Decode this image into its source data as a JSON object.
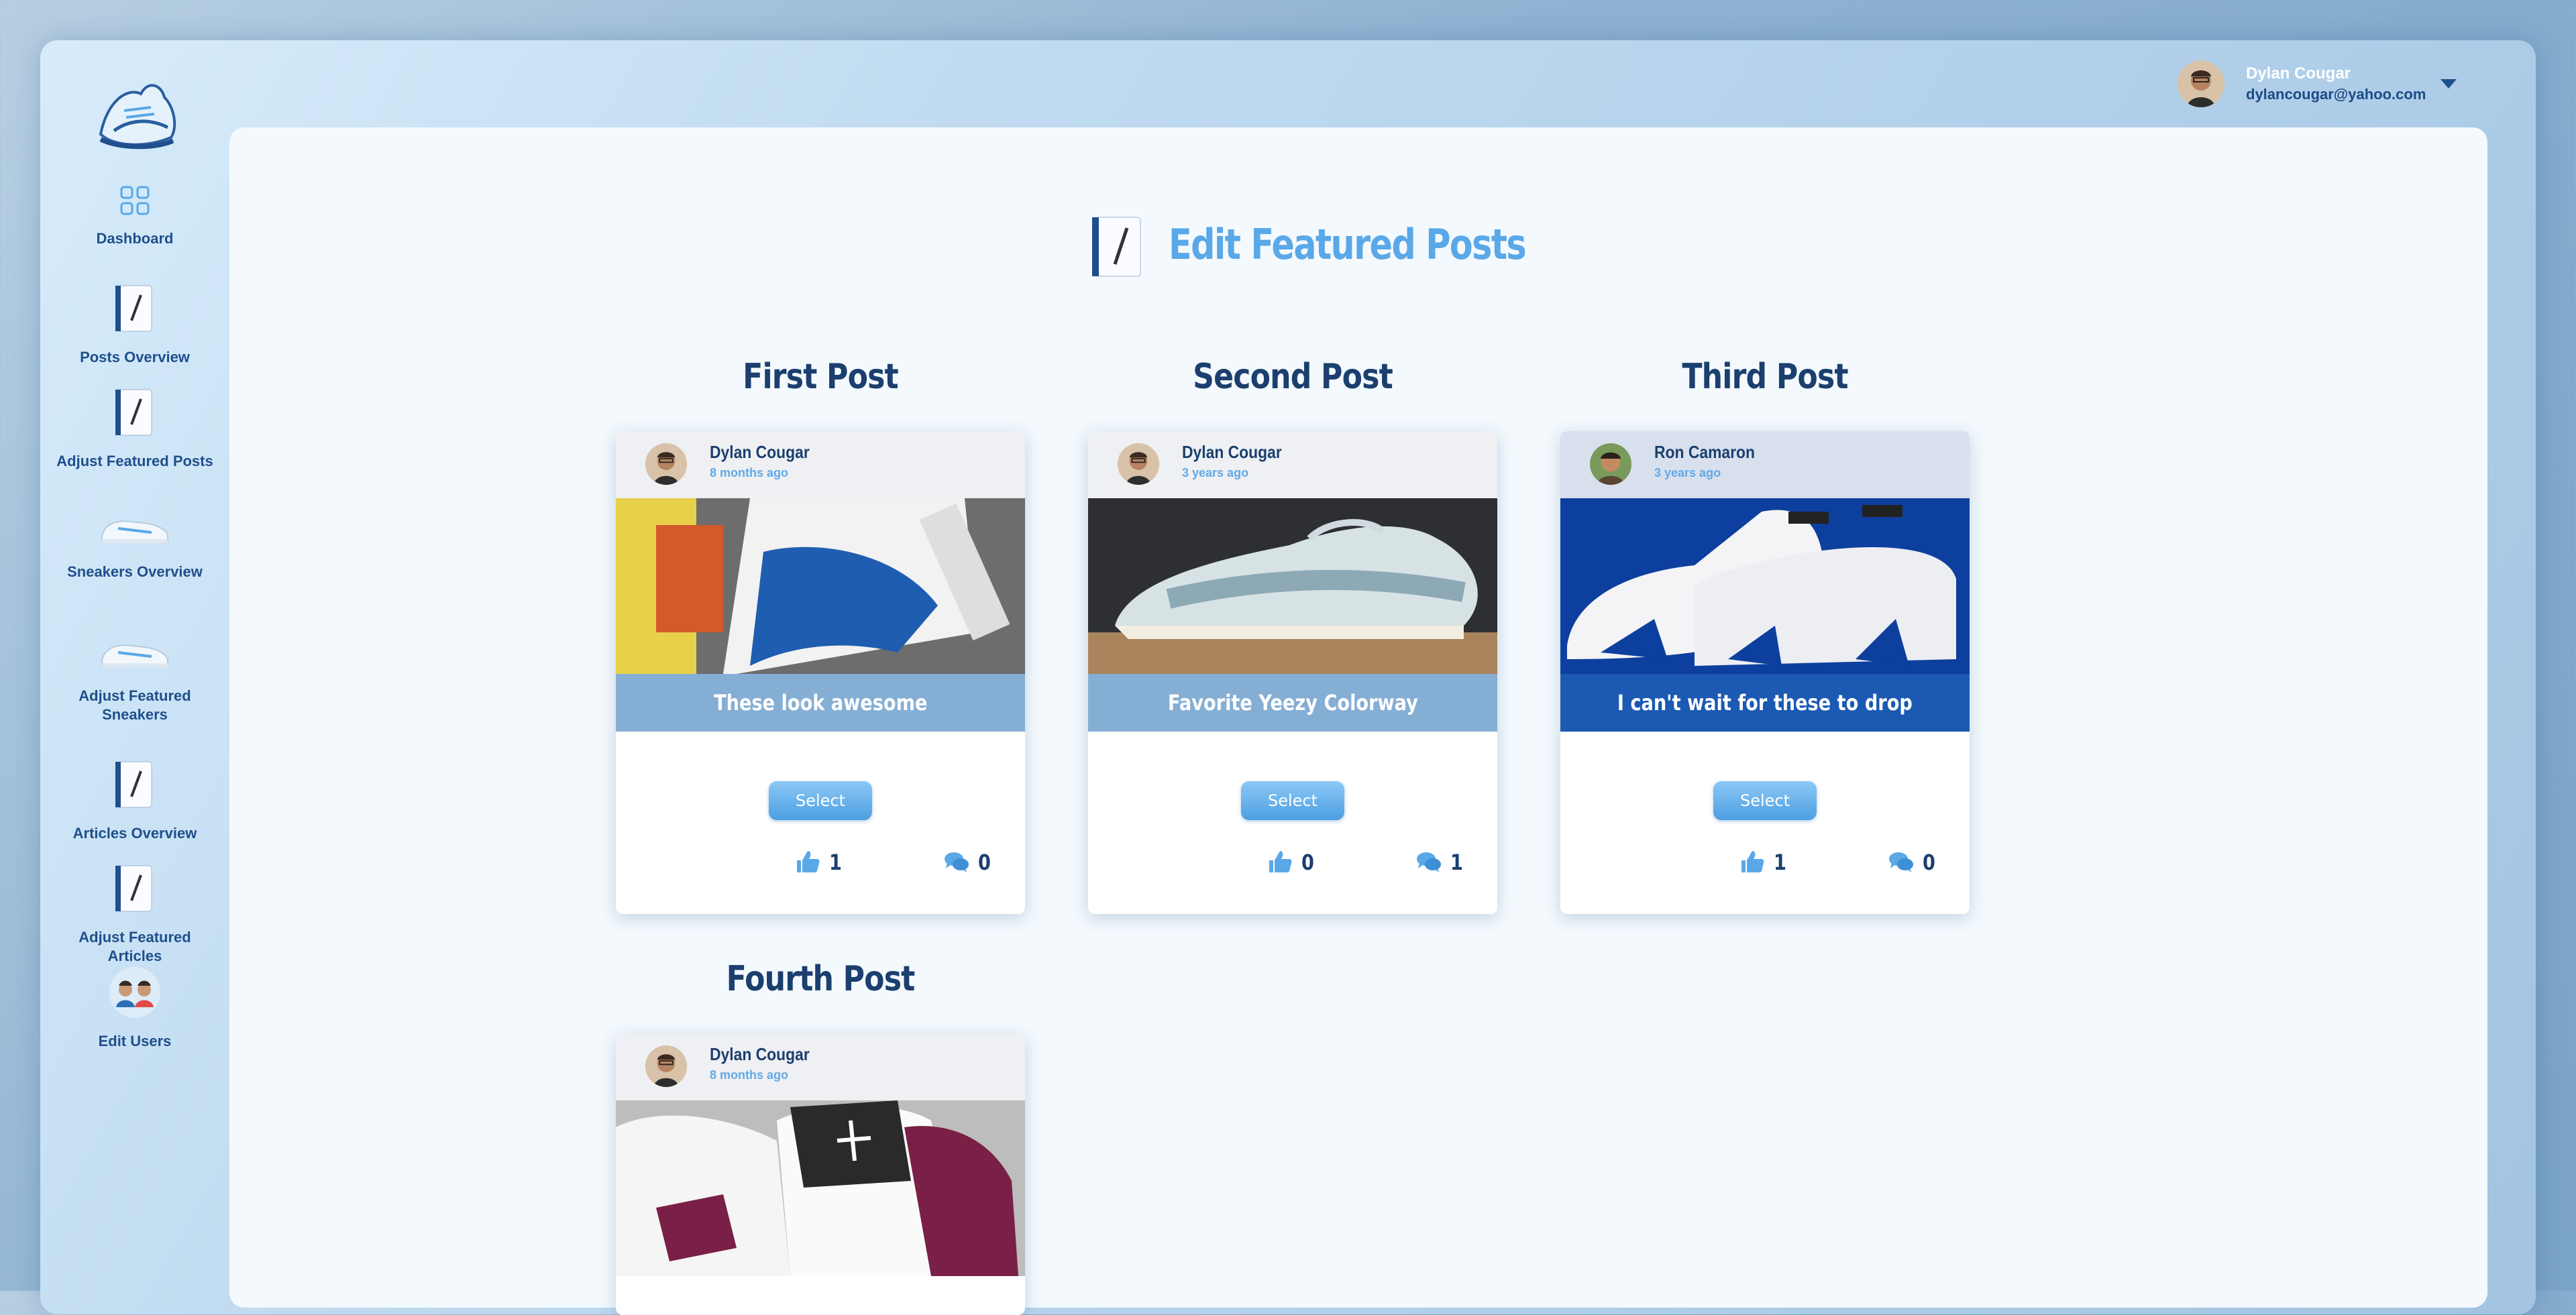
{
  "user": {
    "name": "Dylan Cougar",
    "email": "dylancougar@yahoo.com"
  },
  "sidebar": {
    "items": [
      {
        "label": "Dashboard",
        "icon": "grid-icon"
      },
      {
        "label": "Posts Overview",
        "icon": "notebook-icon"
      },
      {
        "label": "Adjust Featured Posts",
        "icon": "notebook-icon"
      },
      {
        "label": "Sneakers Overview",
        "icon": "sneaker-icon"
      },
      {
        "label": "Adjust Featured Sneakers",
        "icon": "sneaker-icon"
      },
      {
        "label": "Articles Overview",
        "icon": "notebook-icon"
      },
      {
        "label": "Adjust Featured Articles",
        "icon": "notebook-icon"
      },
      {
        "label": "Edit Users",
        "icon": "users-icon"
      }
    ]
  },
  "main": {
    "title": "Edit Featured Posts",
    "slots": [
      {
        "title": "First Post",
        "author": "Dylan Cougar",
        "time": "8 months ago",
        "caption": "These look awesome",
        "button": "Select",
        "likes": "1",
        "comments": "0"
      },
      {
        "title": "Second Post",
        "author": "Dylan Cougar",
        "time": "3 years ago",
        "caption": "Favorite Yeezy Colorway",
        "button": "Select",
        "likes": "0",
        "comments": "1"
      },
      {
        "title": "Third Post",
        "author": "Ron Camaron",
        "time": "3 years ago",
        "caption": "I can't wait for these to drop",
        "button": "Select",
        "likes": "1",
        "comments": "0"
      },
      {
        "title": "Fourth Post",
        "author": "Dylan Cougar",
        "time": "8 months ago"
      }
    ]
  },
  "colors": {
    "accent": "#5aa8e8",
    "navy": "#1b3f6e",
    "sidebar_text": "#1f4f8c"
  }
}
